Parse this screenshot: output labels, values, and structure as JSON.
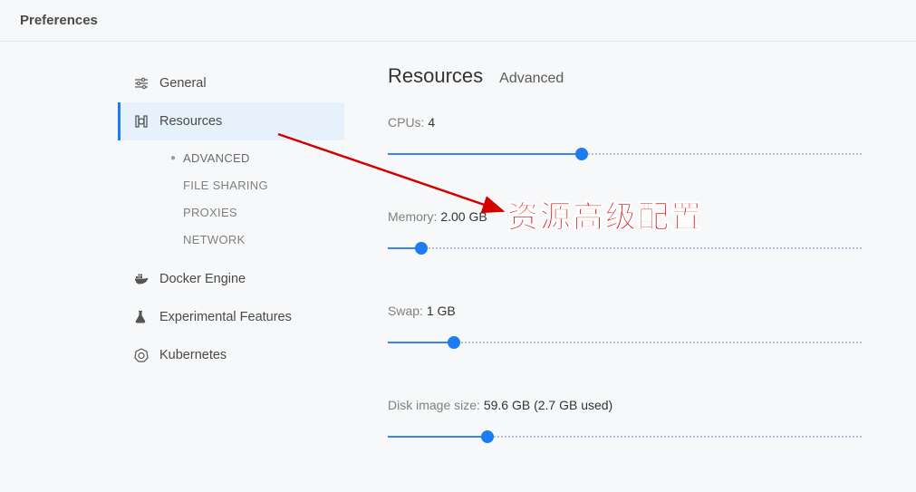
{
  "header": {
    "title": "Preferences"
  },
  "sidebar": {
    "items": {
      "general": {
        "label": "General"
      },
      "resources": {
        "label": "Resources"
      },
      "docker": {
        "label": "Docker Engine"
      },
      "experimental": {
        "label": "Experimental Features"
      },
      "kubernetes": {
        "label": "Kubernetes"
      }
    },
    "resources_sub": {
      "advanced": {
        "label": "ADVANCED"
      },
      "filesharing": {
        "label": "FILE SHARING"
      },
      "proxies": {
        "label": "PROXIES"
      },
      "network": {
        "label": "NETWORK"
      }
    }
  },
  "page": {
    "title": "Resources",
    "section": "Advanced"
  },
  "settings": {
    "cpus": {
      "label": "CPUs:",
      "value": "4",
      "fill_pct": 41
    },
    "memory": {
      "label": "Memory:",
      "value": "2.00 GB",
      "fill_pct": 7
    },
    "swap": {
      "label": "Swap:",
      "value": "1 GB",
      "fill_pct": 14
    },
    "disk": {
      "label": "Disk image size:",
      "value": "59.6 GB (2.7 GB used)",
      "fill_pct": 21
    }
  },
  "annotation": {
    "text": "资源高级配置"
  }
}
